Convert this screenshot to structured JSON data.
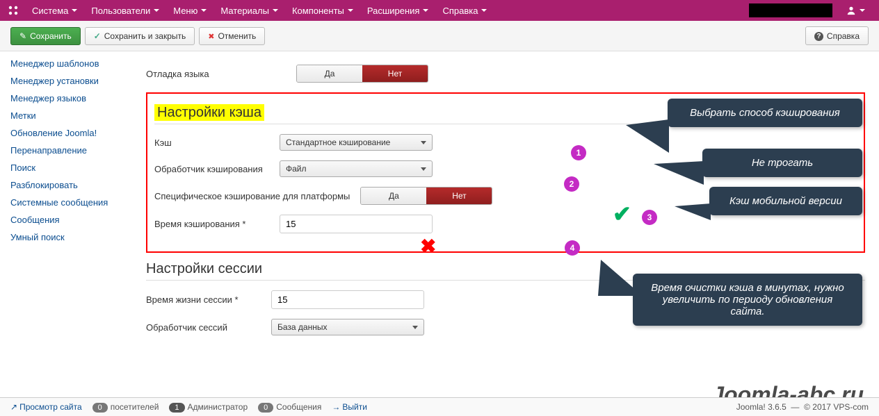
{
  "topnav": {
    "items": [
      "Система",
      "Пользователи",
      "Меню",
      "Материалы",
      "Компоненты",
      "Расширения",
      "Справка"
    ]
  },
  "toolbar": {
    "save": "Сохранить",
    "save_close": "Сохранить и закрыть",
    "cancel": "Отменить",
    "help": "Справка"
  },
  "sidebar": {
    "items": [
      "Менеджер шаблонов",
      "Менеджер установки",
      "Менеджер языков",
      "Метки",
      "Обновление Joomla!",
      "Перенаправление",
      "Поиск",
      "Разблокировать",
      "Системные сообщения",
      "Сообщения",
      "Умный поиск"
    ]
  },
  "form": {
    "debug_lang_label": "Отладка языка",
    "yes": "Да",
    "no": "Нет",
    "cache_section": "Настройки кэша",
    "cache_label": "Кэш",
    "cache_value": "Стандартное кэширование",
    "handler_label": "Обработчик кэширования",
    "handler_value": "Файл",
    "platform_label": "Специфическое кэширование для платформы",
    "cache_time_label": "Время кэширования *",
    "cache_time_value": "15",
    "session_section": "Настройки сессии",
    "session_time_label": "Время жизни сессии *",
    "session_time_value": "15",
    "session_handler_label": "Обработчик сессий",
    "session_handler_value": "База данных"
  },
  "callouts": {
    "c1": "Выбрать способ кэширования",
    "c2": "Не трогать",
    "c3": "Кэш мобильной версии",
    "c4": "Время очистки кэша в минутах, нужно увеличить по периоду обновления сайта."
  },
  "numbers": {
    "n1": "1",
    "n2": "2",
    "n3": "3",
    "n4": "4"
  },
  "watermark": "Joomla-abc.ru",
  "footer": {
    "preview": "Просмотр сайта",
    "visitors_count": "0",
    "visitors": "посетителей",
    "admins_count": "1",
    "admins": "Администратор",
    "messages_count": "0",
    "messages": "Сообщения",
    "logout": "Выйти",
    "version": "Joomla! 3.6.5",
    "copyright": "© 2017 VPS-com"
  }
}
